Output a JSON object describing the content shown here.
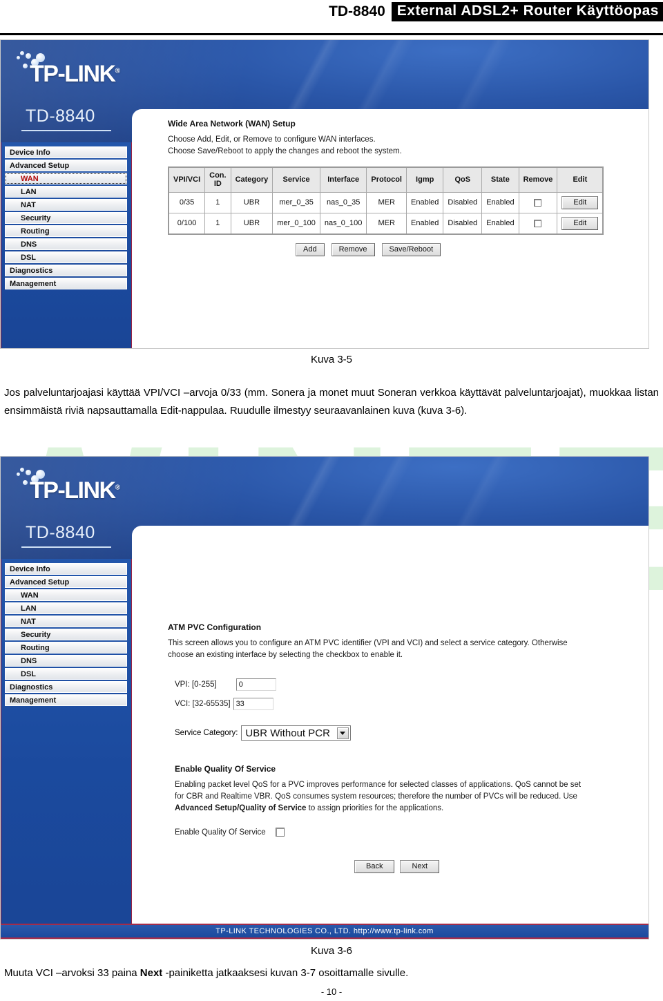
{
  "page_header": {
    "model": "TD-8840",
    "title": "External ADSL2+ Router Käyttöopas"
  },
  "brand": {
    "logo": "TP-LINK",
    "logo_mark": "®",
    "model_name": "TD-8840"
  },
  "sidebar": {
    "items": [
      {
        "label": "Device Info",
        "level": 0,
        "selected": false
      },
      {
        "label": "Advanced Setup",
        "level": 0,
        "selected": false
      },
      {
        "label": "WAN",
        "level": 1,
        "selected": true
      },
      {
        "label": "LAN",
        "level": 1,
        "selected": false
      },
      {
        "label": "NAT",
        "level": 1,
        "selected": false
      },
      {
        "label": "Security",
        "level": 1,
        "selected": false
      },
      {
        "label": "Routing",
        "level": 1,
        "selected": false
      },
      {
        "label": "DNS",
        "level": 1,
        "selected": false
      },
      {
        "label": "DSL",
        "level": 1,
        "selected": false
      },
      {
        "label": "Diagnostics",
        "level": 0,
        "selected": false
      },
      {
        "label": "Management",
        "level": 0,
        "selected": false
      }
    ]
  },
  "screenshot1": {
    "heading": "Wide Area Network (WAN) Setup",
    "desc_line1": "Choose Add, Edit, or Remove to configure WAN interfaces.",
    "desc_line2": "Choose Save/Reboot to apply the changes and reboot the system.",
    "table": {
      "headers": [
        "VPI/VCI",
        "Con. ID",
        "Category",
        "Service",
        "Interface",
        "Protocol",
        "Igmp",
        "QoS",
        "State",
        "Remove",
        "Edit"
      ],
      "header_conid_line1": "Con.",
      "header_conid_line2": "ID",
      "rows": [
        {
          "vpi_vci": "0/35",
          "con_id": "1",
          "category": "UBR",
          "service": "mer_0_35",
          "interface": "nas_0_35",
          "protocol": "MER",
          "igmp": "Enabled",
          "qos": "Disabled",
          "state": "Enabled",
          "remove_checked": false,
          "edit_label": "Edit"
        },
        {
          "vpi_vci": "0/100",
          "con_id": "1",
          "category": "UBR",
          "service": "mer_0_100",
          "interface": "nas_0_100",
          "protocol": "MER",
          "igmp": "Enabled",
          "qos": "Disabled",
          "state": "Enabled",
          "remove_checked": false,
          "edit_label": "Edit"
        }
      ]
    },
    "actions": {
      "add": "Add",
      "remove": "Remove",
      "save_reboot": "Save/Reboot"
    }
  },
  "screenshot2": {
    "heading": "ATM PVC Configuration",
    "desc_line1": "This screen allows you to configure an ATM PVC identifier (VPI and VCI) and select a service category. Otherwise",
    "desc_line2": "choose an existing interface by selecting the checkbox to enable it.",
    "vpi_label": "VPI: [0-255]",
    "vpi_value": "0",
    "vci_label": "VCI: [32-65535]",
    "vci_value": "33",
    "service_category_label": "Service Category:",
    "service_category_value": "UBR Without PCR",
    "qos": {
      "heading": "Enable Quality Of Service",
      "desc_line1": "Enabling packet level QoS for a PVC improves performance for selected classes of applications.  QoS cannot be set",
      "desc_line2": "for CBR and Realtime VBR.  QoS consumes system resources; therefore the number of PVCs will be reduced. Use",
      "desc_line3_bold": "Advanced Setup/Quality of Service",
      "desc_line3_rest": " to assign priorities for the applications.",
      "checkbox_label": "Enable Quality Of Service",
      "checkbox_checked": false
    },
    "buttons": {
      "back": "Back",
      "next": "Next"
    },
    "footer": "TP-LINK TECHNOLOGIES CO., LTD. http://www.tp-link.com"
  },
  "document": {
    "caption1": "Kuva 3-5",
    "paragraph1_a": "Jos palveluntarjoajasi käyttää VPI/VCI –arvoja 0/33 (mm. Sonera ja monet muut Soneran verkkoa käyttävät palveluntarjoajat), muokkaa listan ensimmäistä riviä napsauttamalla Edit-nappulaa. Ruudulle ilmestyy seuraavanlainen kuva (kuva 3-6).",
    "caption2": "Kuva 3-6",
    "paragraph2_pre": "Muuta VCI –arvoksi 33 paina ",
    "paragraph2_bold": "Next",
    "paragraph2_post": " -painiketta jatkaaksesi kuvan 3-7 osoittamalle sivulle.",
    "page_number": "- 10 -",
    "watermark_text": "TWINTEL"
  },
  "colors": {
    "brand_blue": "#1b4a9e",
    "accent_red": "#9b2040",
    "selected_nav": "#b10a0a",
    "watermark_green": "#ddf3dc"
  }
}
